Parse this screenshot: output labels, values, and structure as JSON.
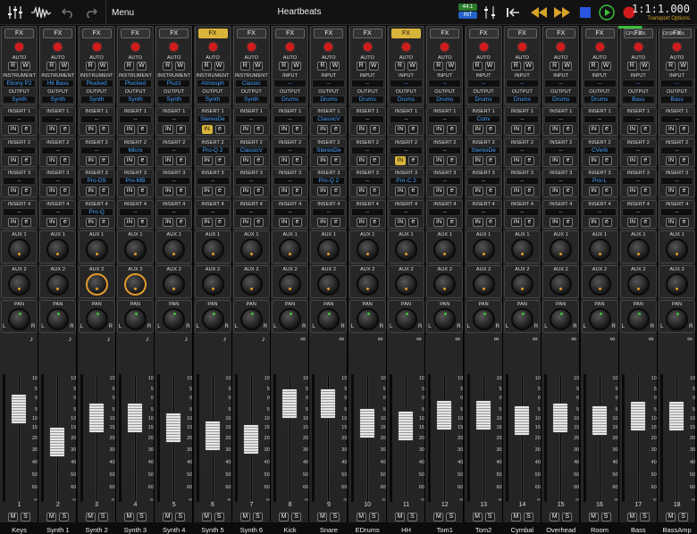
{
  "title": "Heartbeats",
  "menu_label": "Menu",
  "sample_rate": "44.1",
  "sync": "INT",
  "time": "1:1:1.000",
  "transport_options": "Transport Options",
  "cpu": "CPU: 6%",
  "disk": "DISK: 0%",
  "icons": [
    "mixer-icon",
    "waveform-icon",
    "undo-icon",
    "redo-icon",
    "fader-settings-icon",
    "return-to-start-icon",
    "rewind-icon",
    "fast-forward-icon",
    "stop-icon",
    "play-icon",
    "record-icon"
  ],
  "labels": {
    "fx": "FX",
    "auto": "AUTO",
    "r": "R",
    "w": "W",
    "instrument": "INSTRUMENT",
    "output": "OUTPUT",
    "input": "INPUT",
    "in": "IN",
    "e": "e",
    "aux1": "AUX 1",
    "aux2": "AUX 2",
    "pan": "PAN",
    "l": "L",
    "r_pan": "R",
    "m": "M",
    "s": "S",
    "ins1": "INSERT 1",
    "ins2": "INSERT 2",
    "ins3": "INSERT 3",
    "ins4": "INSERT 4",
    "empty": "--",
    "inf": "∞"
  },
  "scale": [
    "10",
    "5",
    "0",
    "5",
    "10",
    "15",
    "20",
    "30",
    "40",
    "50",
    "60",
    "∞"
  ],
  "strips": [
    {
      "num": "1",
      "name": "Keys",
      "type": "INSTRUMENT",
      "src": "Ebony P2",
      "out": "Synth",
      "ins": [
        "--",
        "--",
        "--",
        "--"
      ],
      "fx_on": false,
      "in_on": [
        false,
        false,
        false,
        false
      ],
      "aux2_arc": false,
      "fader": 0.8
    },
    {
      "num": "2",
      "name": "Synth 1",
      "type": "INSTRUMENT",
      "src": "Hit Bass",
      "out": "Synth",
      "ins": [
        "--",
        "--",
        "--",
        "--"
      ],
      "fx_on": false,
      "in_on": [
        false,
        false,
        false,
        false
      ],
      "aux2_arc": false,
      "fader": 0.45
    },
    {
      "num": "3",
      "name": "Synth 2",
      "type": "INSTRUMENT",
      "src": "Plucked",
      "out": "Synth",
      "ins": [
        "--",
        "--",
        "Pro-DS",
        "Pro-Q"
      ],
      "fx_on": false,
      "in_on": [
        false,
        false,
        false,
        false
      ],
      "aux2_arc": true,
      "fader": 0.7
    },
    {
      "num": "4",
      "name": "Synth 3",
      "type": "INSTRUMENT",
      "src": "Plucked",
      "out": "Synth",
      "ins": [
        "--",
        "Micro",
        "Pro-MB",
        "--"
      ],
      "fx_on": false,
      "in_on": [
        false,
        false,
        false,
        false
      ],
      "aux2_arc": true,
      "fader": 0.7
    },
    {
      "num": "5",
      "name": "Synth 4",
      "type": "INSTRUMENT",
      "src": "Pluzz",
      "out": "Synth",
      "ins": [
        "--",
        "--",
        "--",
        "--"
      ],
      "fx_on": false,
      "in_on": [
        false,
        false,
        false,
        false
      ],
      "aux2_arc": false,
      "fader": 0.6
    },
    {
      "num": "6",
      "name": "Synth 5",
      "type": "INSTRUMENT",
      "src": "Atmosph",
      "out": "Synth",
      "ins": [
        "StereoDe",
        "Pro-Q 2",
        "--",
        "--"
      ],
      "fx_on": true,
      "in_on": [
        true,
        false,
        false,
        false
      ],
      "aux2_arc": false,
      "fader": 0.52
    },
    {
      "num": "7",
      "name": "Synth 6",
      "type": "INSTRUMENT",
      "src": "Classic",
      "out": "Synth",
      "ins": [
        "--",
        "ClassicV",
        "--",
        "--"
      ],
      "fx_on": false,
      "in_on": [
        false,
        false,
        false,
        false
      ],
      "aux2_arc": false,
      "fader": 0.48
    },
    {
      "num": "8",
      "name": "Kick",
      "type": "INPUT",
      "src": "--",
      "out": "Drums",
      "ins": [
        "--",
        "--",
        "--",
        "--"
      ],
      "fx_on": false,
      "in_on": [
        false,
        false,
        false,
        false
      ],
      "aux2_arc": false,
      "fader": 0.85
    },
    {
      "num": "9",
      "name": "Snare",
      "type": "INPUT",
      "src": "--",
      "out": "Drums",
      "ins": [
        "ClassicV",
        "StereoDe",
        "Pro-Q 2",
        "--"
      ],
      "fx_on": false,
      "in_on": [
        false,
        false,
        false,
        false
      ],
      "aux2_arc": false,
      "fader": 0.85
    },
    {
      "num": "10",
      "name": "EDrums",
      "type": "INPUT",
      "src": "--",
      "out": "Drums",
      "ins": [
        "--",
        "--",
        "--",
        "--"
      ],
      "fx_on": false,
      "in_on": [
        false,
        false,
        false,
        false
      ],
      "aux2_arc": false,
      "fader": 0.65
    },
    {
      "num": "11",
      "name": "HH",
      "type": "INPUT",
      "src": "--",
      "out": "Drums",
      "ins": [
        "--",
        "--",
        "Pro-C 2",
        "--"
      ],
      "fx_on": true,
      "in_on": [
        false,
        true,
        false,
        false
      ],
      "aux2_arc": false,
      "fader": 0.62
    },
    {
      "num": "12",
      "name": "Tom1",
      "type": "INPUT",
      "src": "--",
      "out": "Drums",
      "ins": [
        "--",
        "--",
        "--",
        "--"
      ],
      "fx_on": false,
      "in_on": [
        false,
        false,
        false,
        false
      ],
      "aux2_arc": false,
      "fader": 0.73
    },
    {
      "num": "13",
      "name": "Tom2",
      "type": "INPUT",
      "src": "--",
      "out": "Drums",
      "ins": [
        "Conv",
        "StereoDe",
        "--",
        "--"
      ],
      "fx_on": false,
      "in_on": [
        false,
        false,
        false,
        false
      ],
      "aux2_arc": false,
      "fader": 0.73
    },
    {
      "num": "14",
      "name": "Cymbal",
      "type": "INPUT",
      "src": "--",
      "out": "Drums",
      "ins": [
        "--",
        "--",
        "--",
        "--"
      ],
      "fx_on": false,
      "in_on": [
        false,
        false,
        false,
        false
      ],
      "aux2_arc": false,
      "fader": 0.68
    },
    {
      "num": "15",
      "name": "Overhead",
      "type": "INPUT",
      "src": "--",
      "out": "Drums",
      "ins": [
        "--",
        "--",
        "--",
        "--"
      ],
      "fx_on": false,
      "in_on": [
        false,
        false,
        false,
        false
      ],
      "aux2_arc": false,
      "fader": 0.7
    },
    {
      "num": "16",
      "name": "Room",
      "type": "INPUT",
      "src": "--",
      "out": "Drums",
      "ins": [
        "--",
        "CVerb",
        "Pro-L",
        "--"
      ],
      "fx_on": false,
      "in_on": [
        false,
        false,
        false,
        false
      ],
      "aux2_arc": false,
      "fader": 0.68
    },
    {
      "num": "17",
      "name": "Bass",
      "type": "INPUT",
      "src": "--",
      "out": "Bass",
      "ins": [
        "--",
        "--",
        "--",
        "--"
      ],
      "fx_on": false,
      "in_on": [
        false,
        false,
        false,
        false
      ],
      "aux2_arc": false,
      "fader": 0.72
    },
    {
      "num": "18",
      "name": "BassAmp",
      "type": "INPUT",
      "src": "--",
      "out": "Bass",
      "ins": [
        "--",
        "--",
        "--",
        "--"
      ],
      "fx_on": false,
      "in_on": [
        false,
        false,
        false,
        false
      ],
      "aux2_arc": false,
      "fader": 0.72
    }
  ]
}
